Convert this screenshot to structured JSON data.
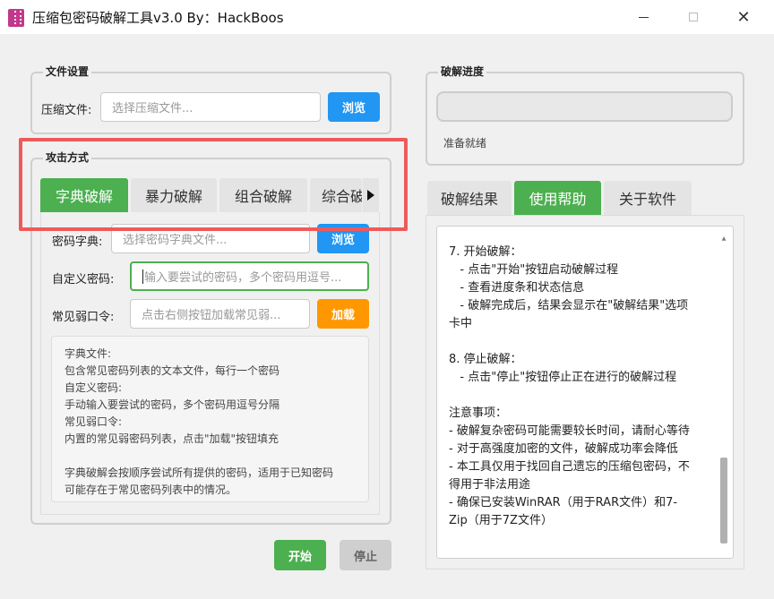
{
  "window": {
    "title": "压缩包密码破解工具v3.0    By：HackBoos",
    "minimize_icon": "minimize-icon",
    "maximize_icon": "maximize-icon",
    "close_label": "✕"
  },
  "file_settings": {
    "group_title": "文件设置",
    "label": "压缩文件:",
    "placeholder": "选择压缩文件...",
    "browse_label": "浏览"
  },
  "attack": {
    "group_title": "攻击方式",
    "tabs": [
      {
        "label": "字典破解",
        "active": true
      },
      {
        "label": "暴力破解",
        "active": false
      },
      {
        "label": "组合破解",
        "active": false
      },
      {
        "label": "综合破解",
        "active": false
      }
    ],
    "tab_scroll_icon": "triangle-right-icon",
    "dict": {
      "label": "密码字典:",
      "placeholder": "选择密码字典文件...",
      "browse_label": "浏览"
    },
    "custom": {
      "label": "自定义密码:",
      "placeholder": "输入要尝试的密码，多个密码用逗号..."
    },
    "weak": {
      "label": "常见弱口令:",
      "placeholder": "点击右侧按钮加载常见弱...",
      "load_label": "加载"
    },
    "info_lines": [
      "字典文件:",
      "包含常见密码列表的文本文件，每行一个密码",
      "自定义密码:",
      "手动输入要尝试的密码，多个密码用逗号分隔",
      "常见弱口令:",
      "内置的常见弱密码列表，点击\"加载\"按钮填充",
      "",
      "字典破解会按顺序尝试所有提供的密码，适用于已知密码",
      "可能存在于常见密码列表中的情况。"
    ]
  },
  "actions": {
    "start_label": "开始",
    "stop_label": "停止"
  },
  "progress": {
    "group_title": "破解进度",
    "value": 0,
    "status": "准备就绪"
  },
  "right_tabs": [
    {
      "label": "破解结果",
      "active": false
    },
    {
      "label": "使用帮助",
      "active": true
    },
    {
      "label": "关于软件",
      "active": false
    }
  ],
  "help_lines": [
    "7. 开始破解：",
    "   - 点击\"开始\"按钮启动破解过程",
    "   - 查看进度条和状态信息",
    "   - 破解完成后，结果会显示在\"破解结果\"选项",
    "卡中",
    "",
    "8. 停止破解：",
    "   - 点击\"停止\"按钮停止正在进行的破解过程",
    "",
    "注意事项：",
    "- 破解复杂密码可能需要较长时间，请耐心等待",
    "- 对于高强度加密的文件，破解成功率会降低",
    "- 本工具仅用于找回自己遗忘的压缩包密码，不",
    "得用于非法用途",
    "- 确保已安装WinRAR（用于RAR文件）和7-",
    "Zip（用于7Z文件）"
  ],
  "colors": {
    "accent_green": "#4caf50",
    "accent_blue": "#2196f3",
    "accent_orange": "#ff9800",
    "highlight_red": "#ee5a5a"
  }
}
